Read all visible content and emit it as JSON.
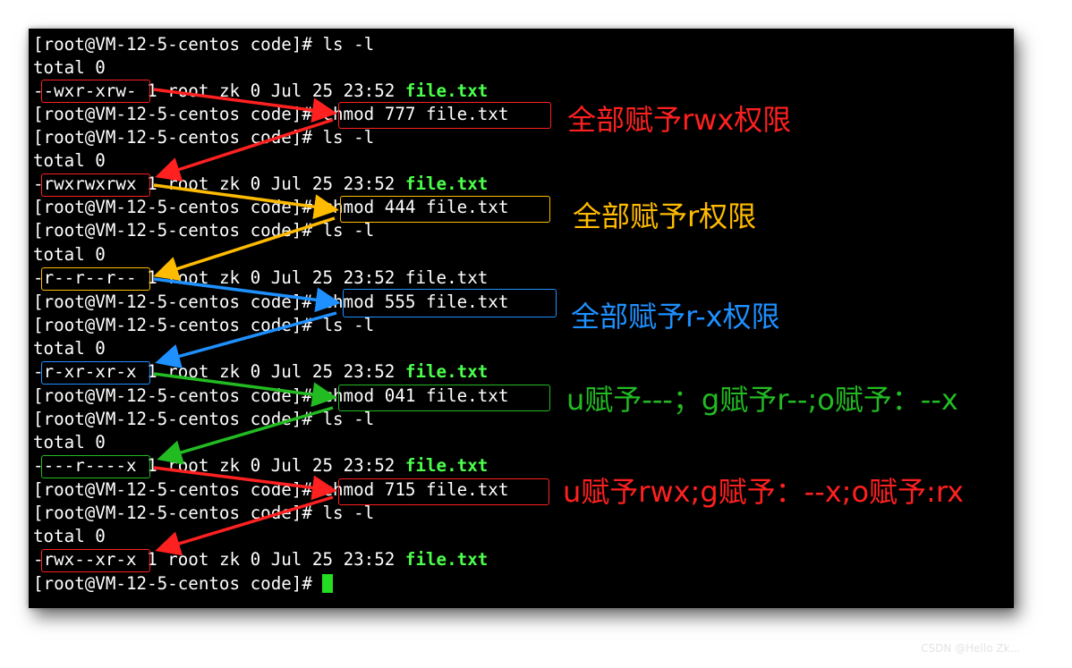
{
  "terminal": {
    "prompt": "[root@VM-12-5-centos code]# ",
    "total_line": "total 0",
    "info": " 1 root zk 0 Jul 25 23:52 ",
    "filename": "file.txt",
    "ls_cmd": "ls -l",
    "commands": [
      "ls -l",
      "chmod 777 file.txt",
      "chmod 444 file.txt",
      "chmod 555 file.txt",
      "chmod 041 file.txt",
      "chmod 715 file.txt"
    ],
    "permissions": [
      "-wxr-xrw-",
      "rwxrwxrwx",
      "r--r--r--",
      "r-xr-xr-x",
      "---r----x",
      "rwx--xr-x"
    ]
  },
  "annotations": [
    {
      "text": "全部赋予rwx权限",
      "color": "#ff2020"
    },
    {
      "text": "全部赋予r权限",
      "color": "#ffbb00"
    },
    {
      "text": "全部赋予r-x权限",
      "color": "#1e90ff"
    },
    {
      "text": "u赋予---；g赋予r--;o赋予：--x",
      "color": "#22bb22"
    },
    {
      "text": "u赋予rwx;g赋予：--x;o赋予:rx",
      "color": "#ff2020"
    }
  ],
  "colors": {
    "red": "#ff2020",
    "orange": "#ffbb00",
    "blue": "#1e90ff",
    "green": "#22bb22",
    "filename_green": "#4cff4c",
    "terminal_bg": "#000000",
    "text": "#ffffff"
  },
  "watermark": "CSDN @Hello Zk..."
}
